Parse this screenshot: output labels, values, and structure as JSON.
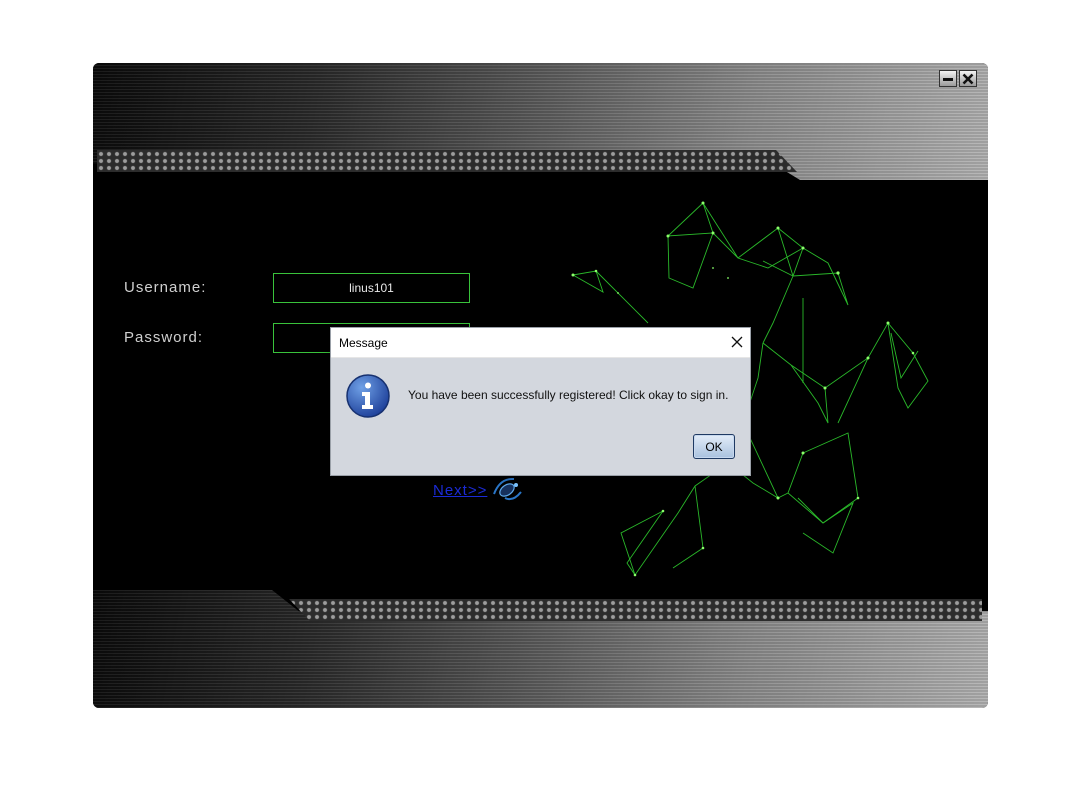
{
  "login_form": {
    "username_label": "Username:",
    "username_value": "linus101",
    "password_label": "Password:",
    "password_value": "",
    "next_link": "Next>>"
  },
  "dialog": {
    "title": "Message",
    "message": "You have been successfully registered! Click okay to sign in.",
    "ok_label": "OK"
  },
  "icons": {
    "minimize": "minimize-icon",
    "close": "close-icon",
    "info": "info-icon",
    "next_decoration": "mouse-gear-icon",
    "background_art": "green-network-graph"
  },
  "colors": {
    "accent_green": "#39c23b",
    "link_blue": "#1b2bd6",
    "dialog_bg": "#d3d7de"
  }
}
